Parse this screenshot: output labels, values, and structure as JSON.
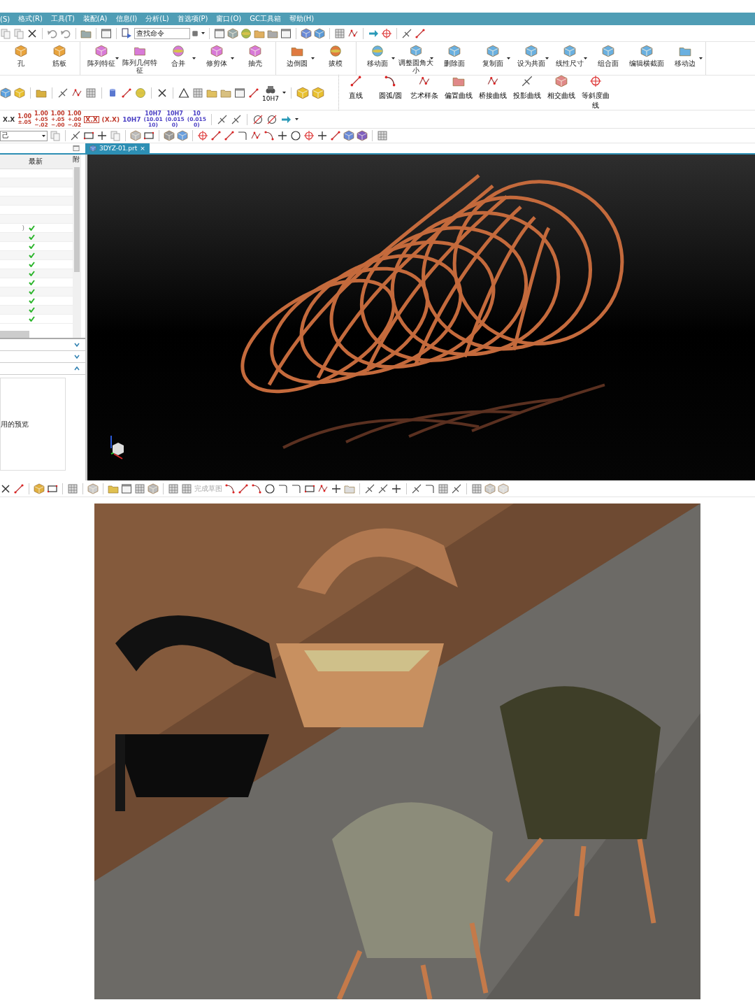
{
  "menu": [
    {
      "label": "(S)"
    },
    {
      "label": "格式(R)"
    },
    {
      "label": "工具(T)"
    },
    {
      "label": "装配(A)"
    },
    {
      "label": "信息(I)"
    },
    {
      "label": "分析(L)"
    },
    {
      "label": "首选项(P)"
    },
    {
      "label": "窗口(O)"
    },
    {
      "label": "GC工具箱"
    },
    {
      "label": "帮助(H)"
    }
  ],
  "search": {
    "placeholder": "查找命令"
  },
  "ribbon_features": [
    {
      "items": [
        {
          "label": "孔",
          "menu": false
        },
        {
          "label": "筋板",
          "menu": false
        }
      ]
    },
    {
      "items": [
        {
          "label": "阵列特征",
          "menu": true
        },
        {
          "label": "阵列几何特征",
          "menu": false
        },
        {
          "label": "合并",
          "menu": true
        },
        {
          "label": "修剪体",
          "menu": true
        },
        {
          "label": "抽壳",
          "menu": false
        }
      ]
    },
    {
      "items": [
        {
          "label": "边倒圆",
          "menu": true
        },
        {
          "label": "拔模",
          "menu": false
        }
      ]
    },
    {
      "items": [
        {
          "label": "移动面",
          "menu": true
        },
        {
          "label": "调整圆角大小",
          "menu": true
        },
        {
          "label": "删除面",
          "menu": false
        },
        {
          "label": "复制面",
          "menu": true
        },
        {
          "label": "设为共面",
          "menu": true
        },
        {
          "label": "线性尺寸",
          "menu": true
        },
        {
          "label": "组合面",
          "menu": false
        },
        {
          "label": "编辑横截面",
          "menu": false
        },
        {
          "label": "移动边",
          "menu": true
        }
      ]
    }
  ],
  "tolerance_button": {
    "label": "10H7"
  },
  "curves": [
    {
      "label": "直线"
    },
    {
      "label": "圆弧/圆"
    },
    {
      "label": "艺术样条"
    },
    {
      "label": "偏置曲线"
    },
    {
      "label": "桥接曲线"
    },
    {
      "label": "投影曲线"
    },
    {
      "label": "相交曲线"
    },
    {
      "label": "等斜度曲线"
    }
  ],
  "dimension_styles": [
    {
      "kind": "plain",
      "main": "X.X",
      "color": "#333333"
    },
    {
      "kind": "stack",
      "main": "1.00",
      "tol": [
        "±.05"
      ],
      "color": "#c0392b"
    },
    {
      "kind": "stack",
      "main": "1.00",
      "tol": [
        "+.05",
        "−.02"
      ],
      "color": "#c0392b"
    },
    {
      "kind": "stack",
      "main": "1.00",
      "tol": [
        "+.05",
        "−.00"
      ],
      "color": "#c0392b"
    },
    {
      "kind": "stack",
      "main": "1.00",
      "tol": [
        "+.00",
        "−.02"
      ],
      "color": "#c0392b"
    },
    {
      "kind": "boxed",
      "main": "X.X",
      "color": "#c0392b"
    },
    {
      "kind": "plain",
      "main": "(X.X)",
      "color": "#c0392b"
    },
    {
      "kind": "plain",
      "main": "10H7",
      "color": "#4a3fc4"
    },
    {
      "kind": "stack",
      "main": "10H7",
      "tol": [
        "(10.01",
        "10)"
      ],
      "color": "#4a3fc4"
    },
    {
      "kind": "stack",
      "main": "10H7",
      "tol": [
        "(0.015",
        "0)"
      ],
      "color": "#4a3fc4"
    },
    {
      "kind": "stack",
      "main": "10",
      "tol": [
        "(0.015",
        "0)"
      ],
      "color": "#4a3fc4"
    }
  ],
  "filter_dropdown": {
    "value": "己"
  },
  "tabs": [
    {
      "label": "3DYZ-01.prt",
      "close": "×",
      "selected": true
    }
  ],
  "navigator": {
    "columns": [
      {
        "label": "最新"
      },
      {
        "label": "附"
      }
    ],
    "rows": [
      {
        "up_to_date": false
      },
      {
        "up_to_date": false
      },
      {
        "up_to_date": false
      },
      {
        "up_to_date": false
      },
      {
        "up_to_date": false
      },
      {
        "up_to_date": false
      },
      {
        "column_1": ")",
        "up_to_date": true
      },
      {
        "up_to_date": true
      },
      {
        "up_to_date": true
      },
      {
        "up_to_date": true
      },
      {
        "up_to_date": true
      },
      {
        "up_to_date": true
      },
      {
        "up_to_date": true
      },
      {
        "up_to_date": true
      },
      {
        "up_to_date": true
      },
      {
        "up_to_date": true
      },
      {
        "up_to_date": true
      }
    ],
    "sections": [
      {
        "expanded": false
      },
      {
        "expanded": false
      },
      {
        "expanded": true
      }
    ],
    "preview_text": "用的预览"
  },
  "sketch_toolbar": {
    "finish_sketch": {
      "label": "完成草图",
      "disabled": true
    }
  }
}
